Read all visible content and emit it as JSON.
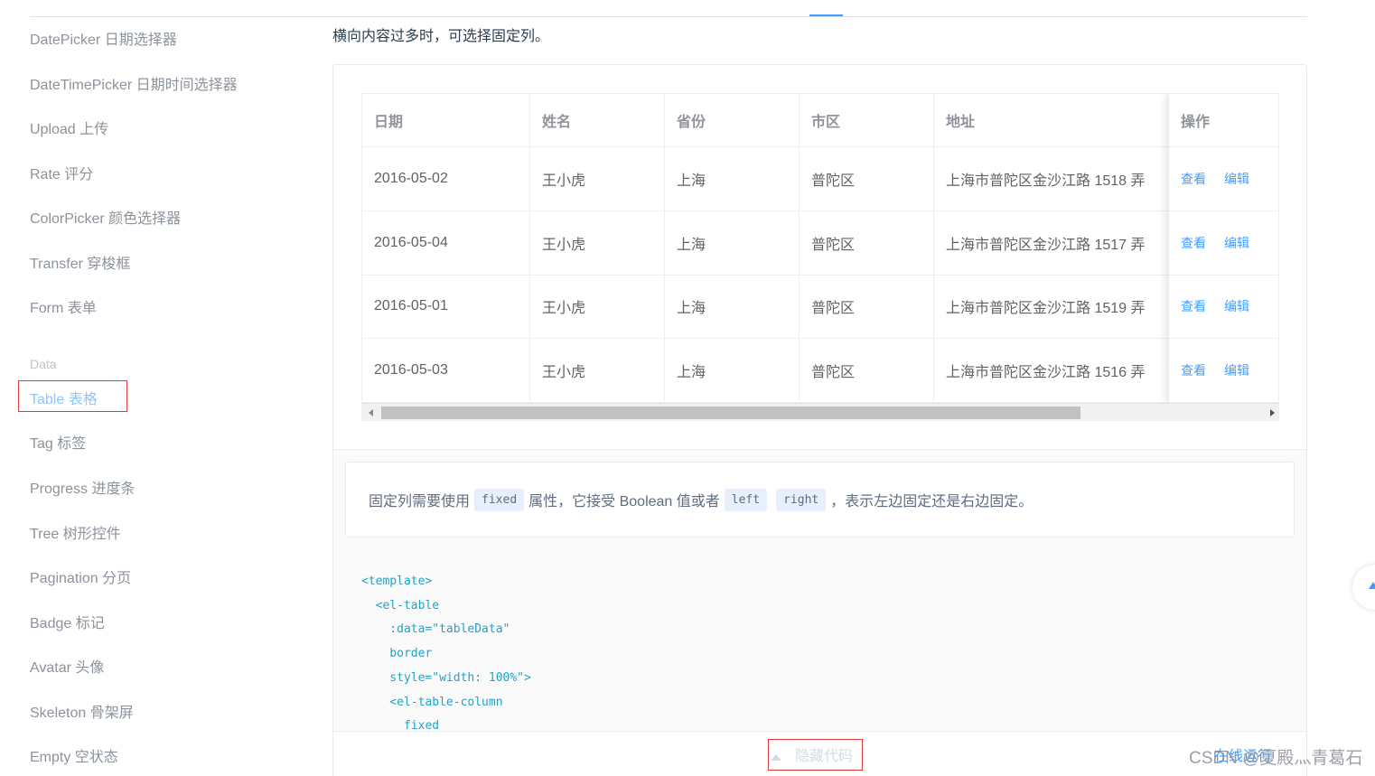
{
  "sidebar": {
    "items": [
      {
        "label": "DatePicker 日期选择器"
      },
      {
        "label": "DateTimePicker 日期时间选择器"
      },
      {
        "label": "Upload 上传"
      },
      {
        "label": "Rate 评分"
      },
      {
        "label": "ColorPicker 颜色选择器"
      },
      {
        "label": "Transfer 穿梭框"
      },
      {
        "label": "Form 表单"
      }
    ],
    "group_label": "Data",
    "data_items": [
      {
        "label": "Table 表格",
        "active": true
      },
      {
        "label": "Tag 标签"
      },
      {
        "label": "Progress 进度条"
      },
      {
        "label": "Tree 树形控件"
      },
      {
        "label": "Pagination 分页"
      },
      {
        "label": "Badge 标记"
      },
      {
        "label": "Avatar 头像"
      },
      {
        "label": "Skeleton 骨架屏"
      },
      {
        "label": "Empty 空状态"
      }
    ]
  },
  "content": {
    "intro": "横向内容过多时，可选择固定列。",
    "table": {
      "headers": [
        "日期",
        "姓名",
        "省份",
        "市区",
        "地址",
        "操作"
      ],
      "rows": [
        [
          "2016-05-02",
          "王小虎",
          "上海",
          "普陀区",
          "上海市普陀区金沙江路 1518 弄"
        ],
        [
          "2016-05-04",
          "王小虎",
          "上海",
          "普陀区",
          "上海市普陀区金沙江路 1517 弄"
        ],
        [
          "2016-05-01",
          "王小虎",
          "上海",
          "普陀区",
          "上海市普陀区金沙江路 1519 弄"
        ],
        [
          "2016-05-03",
          "王小虎",
          "上海",
          "普陀区",
          "上海市普陀区金沙江路 1516 弄"
        ]
      ],
      "actions": {
        "view": "查看",
        "edit": "编辑"
      },
      "horizontal_scroll_position": 0.0
    },
    "description": {
      "before": "固定列需要使用",
      "code1": "fixed",
      "mid1": "属性，它接受 Boolean 值或者",
      "code2": "left",
      "code3": "right",
      "after": "，表示左边固定还是右边固定。"
    },
    "code_lines": [
      "<template>",
      "  <el-table",
      "    :data=\"tableData\"",
      "    border",
      "    style=\"width: 100%\">",
      "    <el-table-column",
      "      fixed"
    ],
    "control": {
      "hide_code": "隐藏代码",
      "online": "在线运行"
    }
  },
  "watermark": "CSDN @夏殿灬青葛石",
  "colors": {
    "accent": "#409eff",
    "highlight_box": "#e2393b",
    "active_nav": "#8cc5ff"
  }
}
